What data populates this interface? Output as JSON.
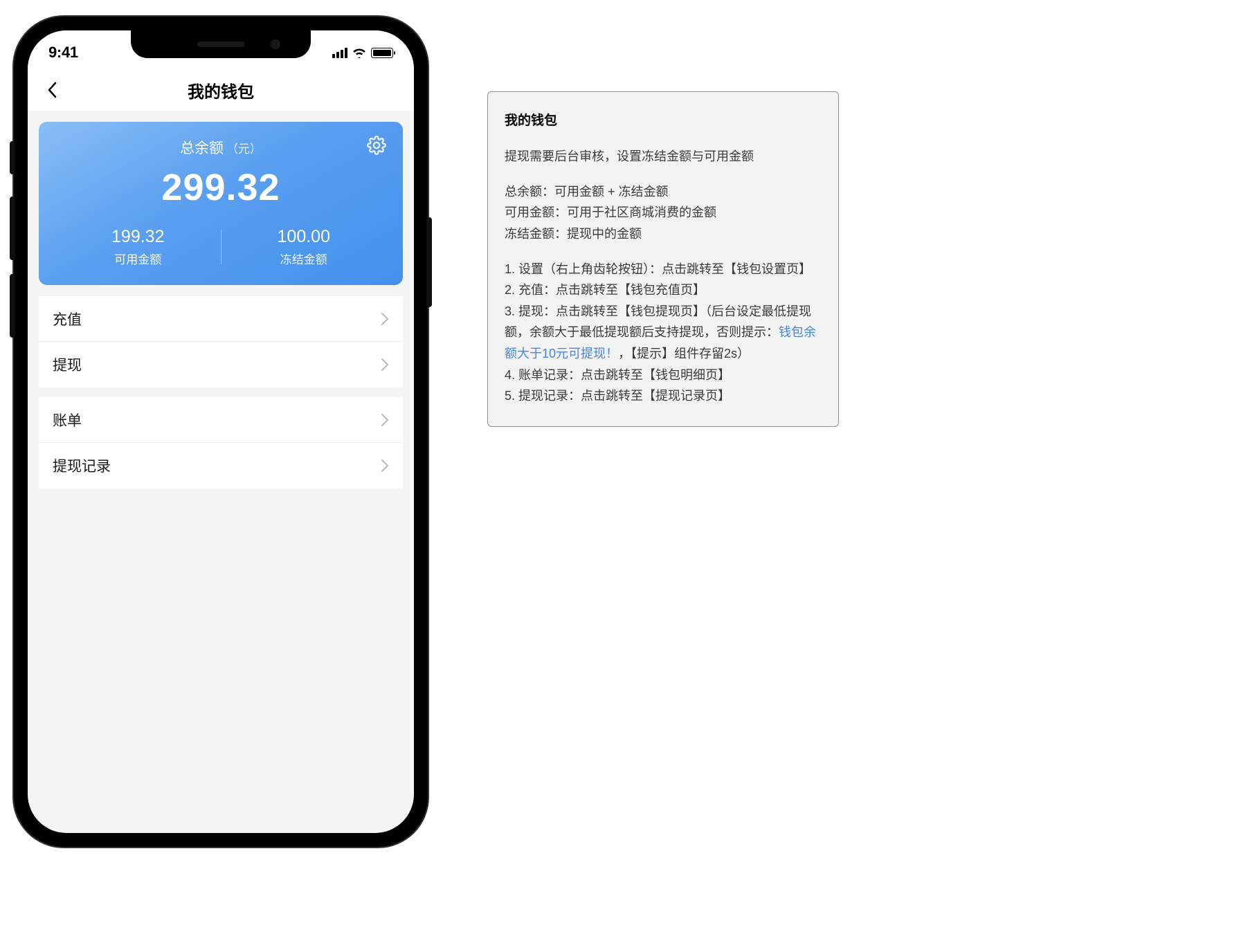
{
  "status": {
    "time": "9:41"
  },
  "nav": {
    "title": "我的钱包"
  },
  "balance": {
    "label": "总余额",
    "unit": "（元）",
    "amount": "299.32",
    "available": {
      "value": "199.32",
      "label": "可用金额"
    },
    "frozen": {
      "value": "100.00",
      "label": "冻结金额"
    }
  },
  "menu": {
    "group1": [
      {
        "label": "充值"
      },
      {
        "label": "提现"
      }
    ],
    "group2": [
      {
        "label": "账单"
      },
      {
        "label": "提现记录"
      }
    ]
  },
  "doc": {
    "title": "我的钱包",
    "intro": "提现需要后台审核，设置冻结金额与可用金额",
    "defs": {
      "l1": "总余额：可用金额 + 冻结金额",
      "l2": "可用金额：可用于社区商城消费的金额",
      "l3": "冻结金额：提现中的金额"
    },
    "list": {
      "i1": "1. 设置（右上角齿轮按钮）：点击跳转至【钱包设置页】",
      "i2": "2. 充值：点击跳转至【钱包充值页】",
      "i3a": "3. 提现：点击跳转至【钱包提现页】（后台设定最低提现额，余额大于最低提现额后支持提现，否则提示：",
      "i3link": "钱包余额大于10元可提现！",
      "i3b": "，【提示】组件存留2s）",
      "i4": "4. 账单记录：点击跳转至【钱包明细页】",
      "i5": "5. 提现记录：点击跳转至【提现记录页】"
    }
  }
}
